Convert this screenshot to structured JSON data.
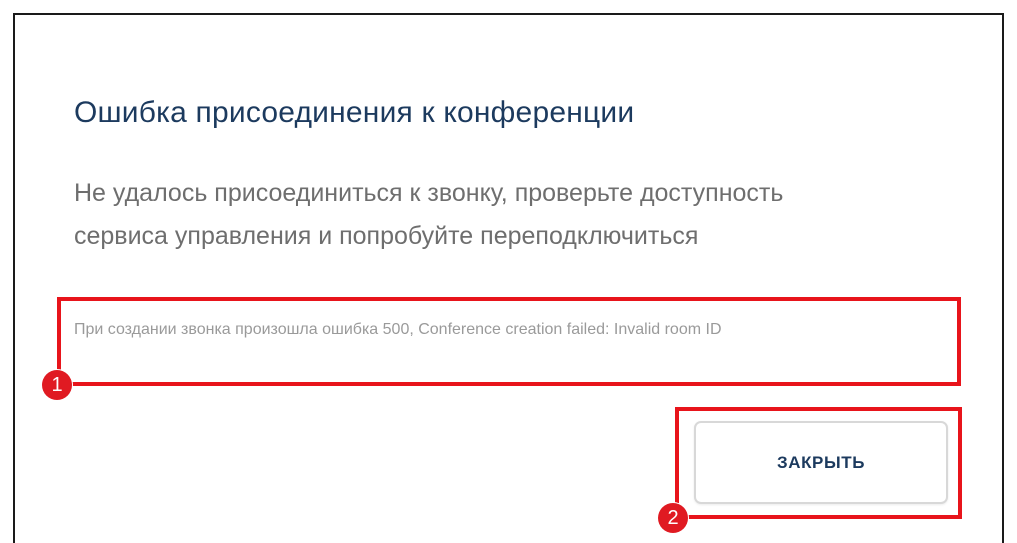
{
  "dialog": {
    "title": "Ошибка присоединения к конференции",
    "message": "Не удалось присоединиться к звонку, проверьте доступность сервиса управления и попробуйте переподключиться",
    "error_details": "При создании звонка произошла ошибка 500, Conference creation failed: Invalid room ID",
    "close_label": "ЗАКРЫТЬ"
  },
  "annotations": {
    "marker_1": "1",
    "marker_2": "2",
    "highlight_color": "#e8141b"
  },
  "colors": {
    "title": "#1c3a5e",
    "message": "#6e6e6e",
    "details": "#9a9a9a",
    "button_text": "#1c3a5e"
  }
}
